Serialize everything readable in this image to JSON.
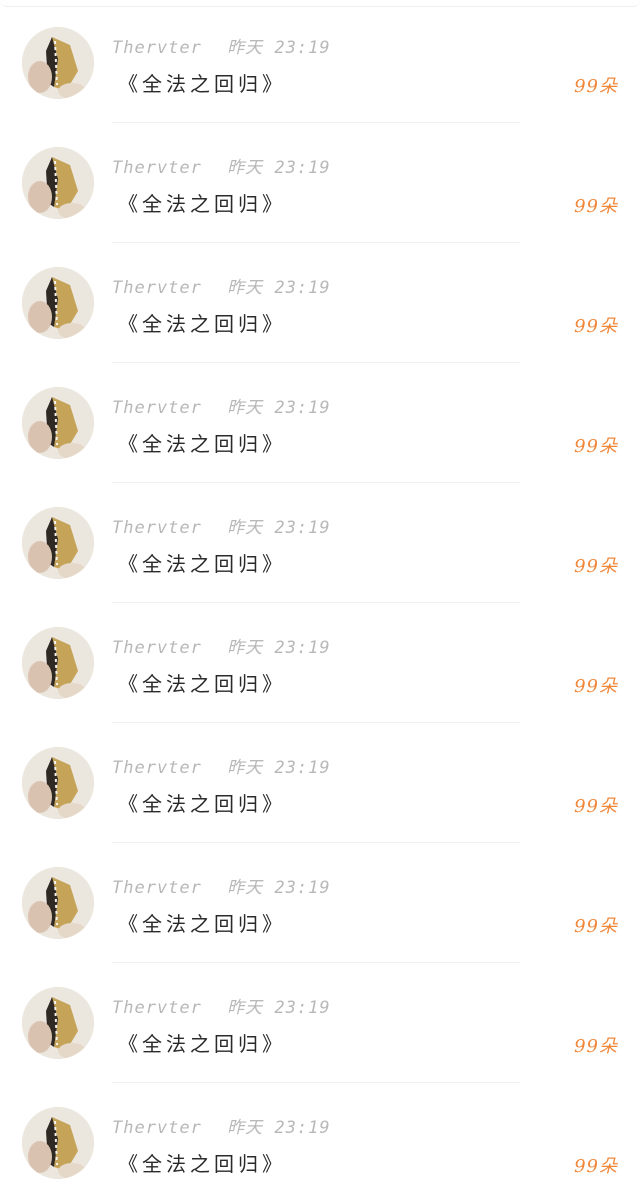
{
  "messages": [
    {
      "author": "Thervter",
      "date": "昨天",
      "time": "23:19",
      "title": "《全法之回归》",
      "count": "99朵"
    },
    {
      "author": "Thervter",
      "date": "昨天",
      "time": "23:19",
      "title": "《全法之回归》",
      "count": "99朵"
    },
    {
      "author": "Thervter",
      "date": "昨天",
      "time": "23:19",
      "title": "《全法之回归》",
      "count": "99朵"
    },
    {
      "author": "Thervter",
      "date": "昨天",
      "time": "23:19",
      "title": "《全法之回归》",
      "count": "99朵"
    },
    {
      "author": "Thervter",
      "date": "昨天",
      "time": "23:19",
      "title": "《全法之回归》",
      "count": "99朵"
    },
    {
      "author": "Thervter",
      "date": "昨天",
      "time": "23:19",
      "title": "《全法之回归》",
      "count": "99朵"
    },
    {
      "author": "Thervter",
      "date": "昨天",
      "time": "23:19",
      "title": "《全法之回归》",
      "count": "99朵"
    },
    {
      "author": "Thervter",
      "date": "昨天",
      "time": "23:19",
      "title": "《全法之回归》",
      "count": "99朵"
    },
    {
      "author": "Thervter",
      "date": "昨天",
      "time": "23:19",
      "title": "《全法之回归》",
      "count": "99朵"
    },
    {
      "author": "Thervter",
      "date": "昨天",
      "time": "23:19",
      "title": "《全法之回归》",
      "count": "99朵"
    }
  ],
  "colors": {
    "meta": "#b8b8b8",
    "title": "#2a2a2a",
    "count": "#f0883a",
    "divider": "#f0f0f0"
  },
  "icons": {
    "avatar": "avatar-photo-icon"
  }
}
